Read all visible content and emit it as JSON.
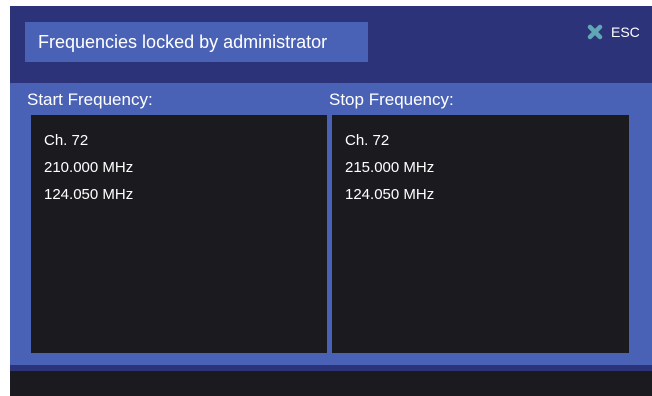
{
  "colors": {
    "background": "#2c3379",
    "panel": "#4a62b5",
    "list_background": "#1b1a1f",
    "esc_icon": "#5fa7b4",
    "text": "#ffffff"
  },
  "header": {
    "title": "Frequencies locked by administrator",
    "esc_label": "ESC",
    "esc_icon": "close-x-icon"
  },
  "start": {
    "label": "Start Frequency:",
    "items": [
      "Ch. 72",
      "210.000 MHz",
      "124.050 MHz"
    ]
  },
  "stop": {
    "label": "Stop Frequency:",
    "items": [
      "Ch. 72",
      "215.000 MHz",
      "124.050 MHz"
    ]
  }
}
